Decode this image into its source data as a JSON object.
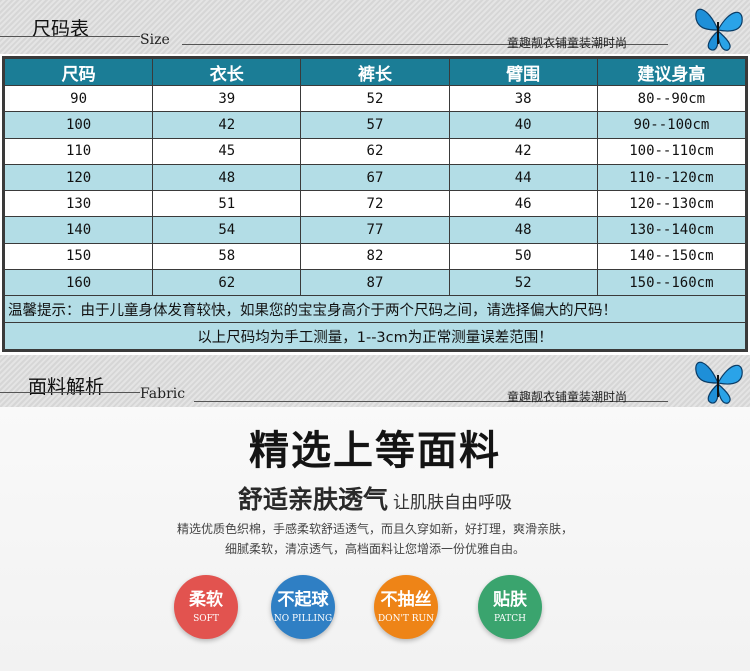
{
  "size_header": {
    "title": "尺码表",
    "subtitle_en": "Size",
    "shop": "童趣靓衣铺童装潮时尚"
  },
  "size_table": {
    "columns": [
      "尺码",
      "衣长",
      "裤长",
      "臂围",
      "建议身高"
    ],
    "rows": [
      [
        "90",
        "39",
        "52",
        "38",
        "80--90cm"
      ],
      [
        "100",
        "42",
        "57",
        "40",
        "90--100cm"
      ],
      [
        "110",
        "45",
        "62",
        "42",
        "100--110cm"
      ],
      [
        "120",
        "48",
        "67",
        "44",
        "110--120cm"
      ],
      [
        "130",
        "51",
        "72",
        "46",
        "120--130cm"
      ],
      [
        "140",
        "54",
        "77",
        "48",
        "130--140cm"
      ],
      [
        "150",
        "58",
        "82",
        "50",
        "140--150cm"
      ],
      [
        "160",
        "62",
        "87",
        "52",
        "150--160cm"
      ]
    ],
    "tip_line1": "温馨提示：由于儿童身体发育较快，如果您的宝宝身高介于两个尺码之间，请选择偏大的尺码！",
    "tip_line2": "以上尺码均为手工测量，1--3cm为正常测量误差范围！"
  },
  "fabric_header": {
    "title": "面料解析",
    "subtitle_en": "Fabric",
    "shop": "童趣靓衣铺童装潮时尚"
  },
  "fabric": {
    "headline": "精选上等面料",
    "sub_main": "舒适亲肤透气",
    "sub_small": "让肌肤自由呼吸",
    "desc_line1": "精选优质色织棉，手感柔软舒适透气，而且久穿如新，好打理，爽滑亲肤，",
    "desc_line2": "细腻柔软，清凉透气，高档面料让您增添一份优雅自由。",
    "badges": [
      {
        "cn": "柔软",
        "en": "SOFT",
        "color": "#e2534f"
      },
      {
        "cn": "不起球",
        "en": "NO PILLING",
        "color": "#2f7fc4"
      },
      {
        "cn": "不抽丝",
        "en": "DON'T RUN",
        "color": "#ee8417"
      },
      {
        "cn": "贴肤",
        "en": "PATCH",
        "color": "#3aa46e"
      }
    ]
  },
  "icons": {
    "butterfly": "butterfly-icon",
    "butterfly_color": "#1e8fd8"
  }
}
